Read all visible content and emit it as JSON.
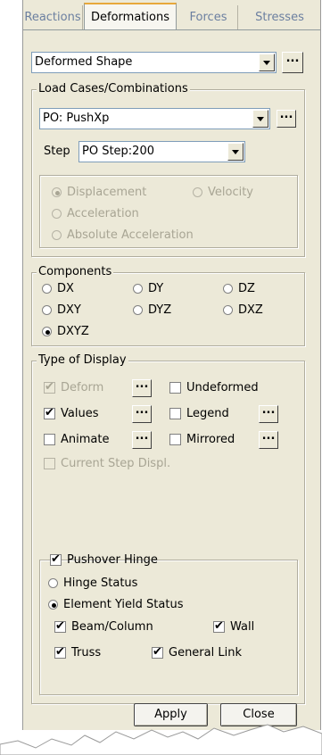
{
  "tabs": [
    "Reactions",
    "Deformations",
    "Forces",
    "Stresses"
  ],
  "display_type": {
    "value": "Deformed Shape",
    "more": "..."
  },
  "load_cases": {
    "title": "Load Cases/Combinations",
    "case_value": "PO: PushXp",
    "more": "...",
    "step_label": "Step",
    "step_value": "PO Step:200",
    "options": [
      "Displacement",
      "Velocity",
      "Acceleration",
      "Absolute Acceleration"
    ]
  },
  "components": {
    "title": "Components",
    "options": [
      "DX",
      "DY",
      "DZ",
      "DXY",
      "DYZ",
      "DXZ",
      "DXYZ"
    ],
    "selected": "DXYZ"
  },
  "type_of_display": {
    "title": "Type of Display",
    "deform": "Deform",
    "undeformed": "Undeformed",
    "values": "Values",
    "legend": "Legend",
    "animate": "Animate",
    "mirrored": "Mirrored",
    "current_step": "Current Step Displ.",
    "more": "..."
  },
  "pushover": {
    "title": "Pushover Hinge",
    "hinge_status": "Hinge Status",
    "element_yield": "Element Yield Status",
    "beam_column": "Beam/Column",
    "wall": "Wall",
    "truss": "Truss",
    "general_link": "General Link"
  },
  "buttons": {
    "apply": "Apply",
    "close": "Close"
  }
}
